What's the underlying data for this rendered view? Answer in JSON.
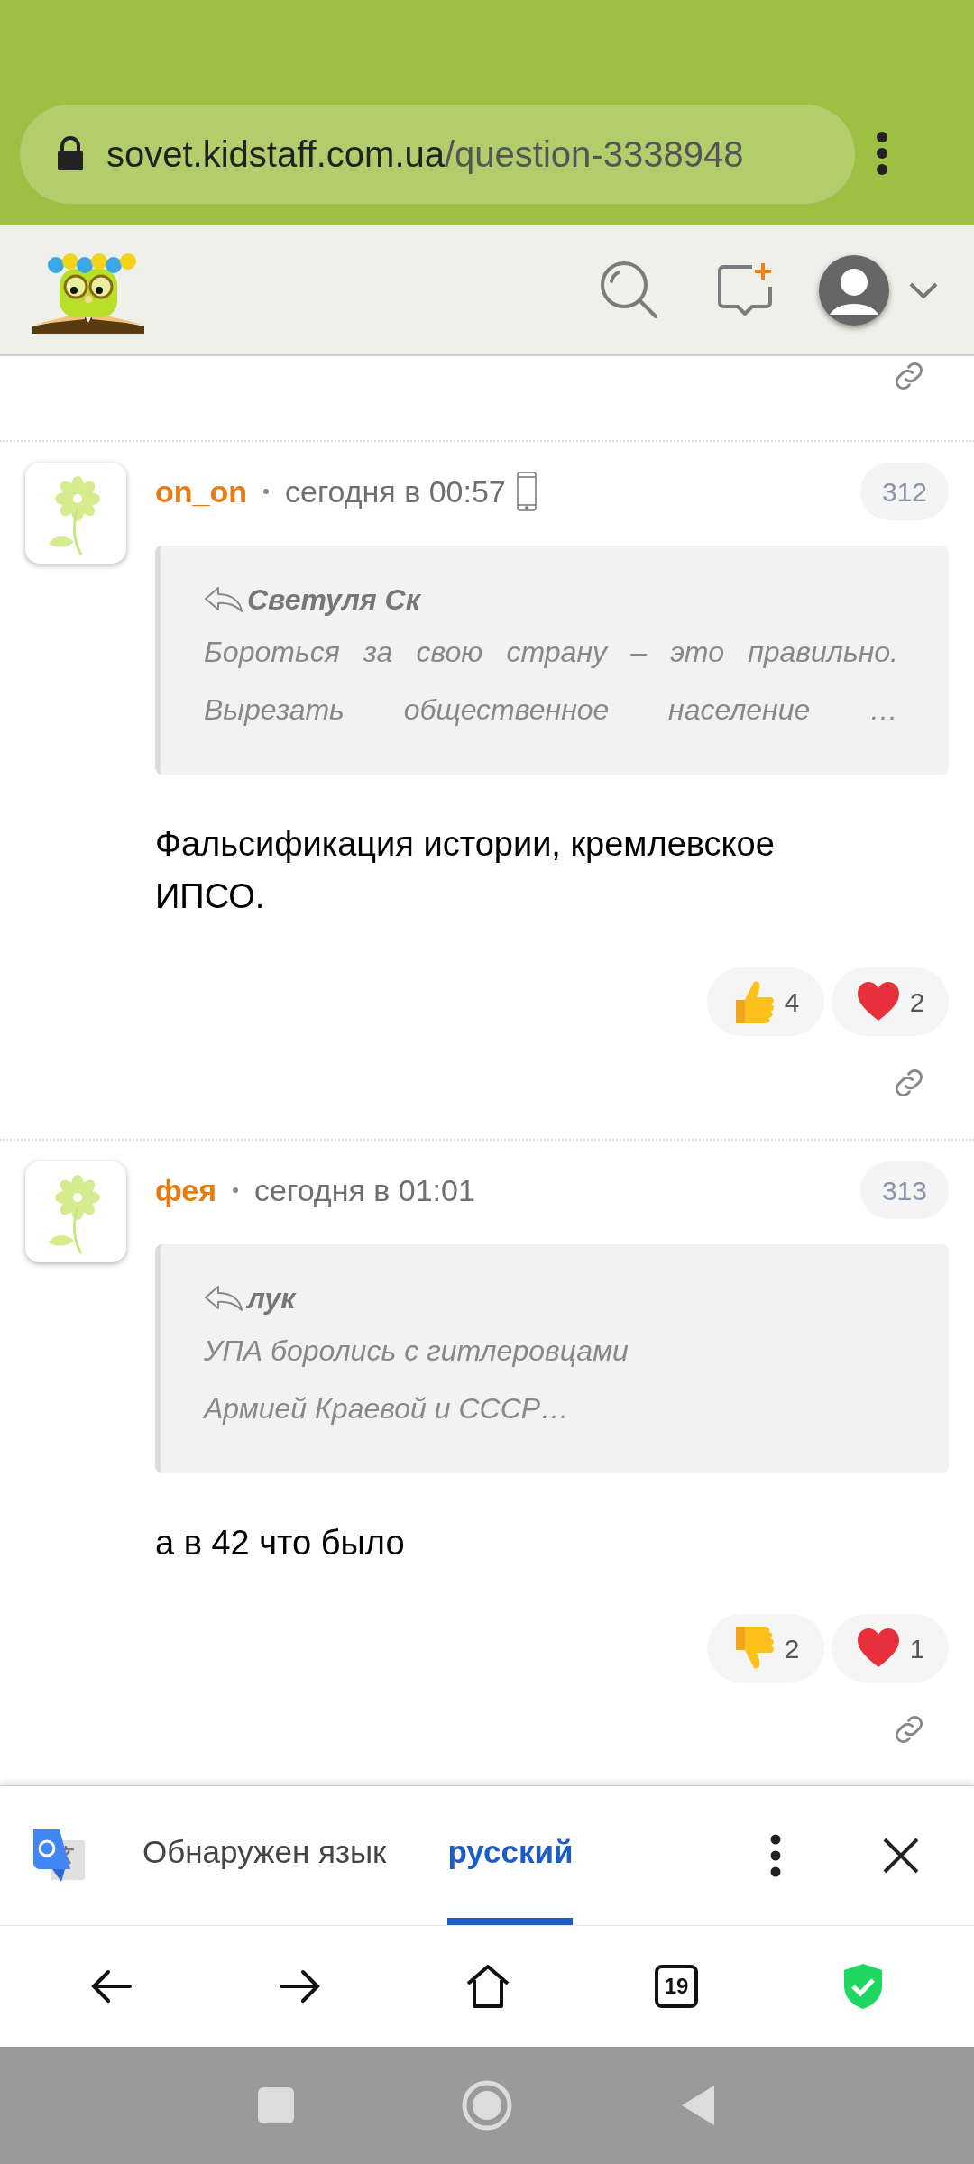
{
  "address_bar": {
    "domain": "sovet.kidstaff.com.ua",
    "path": "/question-3338948"
  },
  "comments": [
    {
      "author": "on_on",
      "time": "сегодня в 00:57",
      "from_mobile": true,
      "number": "312",
      "quote": {
        "author": "Светуля Ск",
        "lines": [
          "Бороться за свою страну – это правильно.",
          "Вырезать общественное население …"
        ],
        "justified": true
      },
      "body": "Фальсификация истории, кремлевское ИПСО.",
      "reactions": [
        {
          "kind": "thumbs_up",
          "count": "4"
        },
        {
          "kind": "heart",
          "count": "2"
        }
      ]
    },
    {
      "author": "фея",
      "time": "сегодня в 01:01",
      "from_mobile": false,
      "number": "313",
      "quote": {
        "author": "лук",
        "lines": [
          "УПА боролись с гитлеровцами",
          "Армией Краевой и СССР…"
        ],
        "justified": false
      },
      "body": "а в 42 что было",
      "reactions": [
        {
          "kind": "thumbs_down",
          "count": "2"
        },
        {
          "kind": "heart",
          "count": "1"
        }
      ]
    }
  ],
  "translate_bar": {
    "tabs": [
      {
        "label": "Обнаружен язык",
        "selected": false
      },
      {
        "label": "русский",
        "selected": true
      }
    ]
  },
  "nav_bar": {
    "tab_count": "19"
  }
}
